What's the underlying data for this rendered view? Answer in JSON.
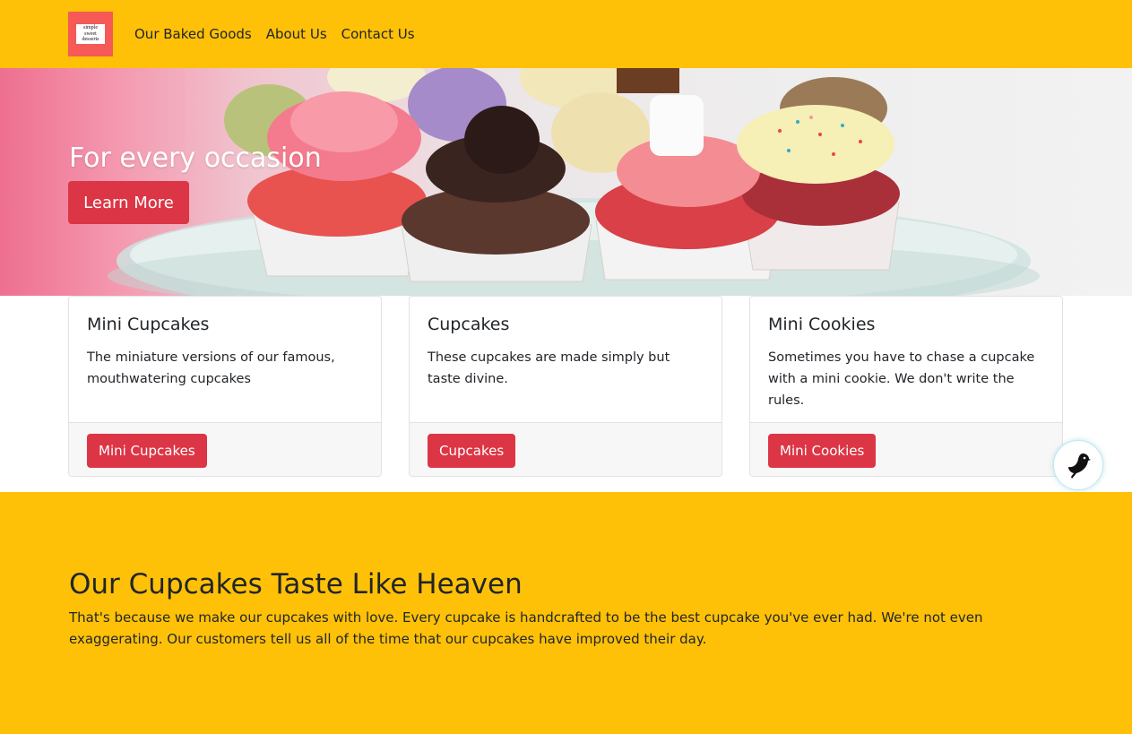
{
  "nav": {
    "logo_lines": [
      "simple",
      "sweet",
      "desserts"
    ],
    "links": [
      "Our Baked Goods",
      "About Us",
      "Contact Us"
    ]
  },
  "hero": {
    "title": "For every occasion",
    "button": "Learn More"
  },
  "cards": [
    {
      "title": "Mini Cupcakes",
      "text": "The miniature versions of our famous, mouthwatering cupcakes",
      "button": "Mini Cupcakes"
    },
    {
      "title": "Cupcakes",
      "text": "These cupcakes are made simply but taste divine.",
      "button": "Cupcakes"
    },
    {
      "title": "Mini Cookies",
      "text": "Sometimes you have to chase a cupcake with a mini cookie. We don't write the rules.",
      "button": "Mini Cookies"
    }
  ],
  "about": {
    "title": "Our Cupcakes Taste Like Heaven",
    "text": "That's because we make our cupcakes with love. Every cupcake is handcrafted to be the best cupcake you've ever had. We're not even exaggerating. Our customers tell us all of the time that our cupcakes have improved their day."
  },
  "widget": {
    "icon": "bird-icon"
  },
  "colors": {
    "navbar": "#ffc107",
    "logo_bg": "#f55a57",
    "button": "#dc3545",
    "bottom_bg": "#ffc107"
  }
}
